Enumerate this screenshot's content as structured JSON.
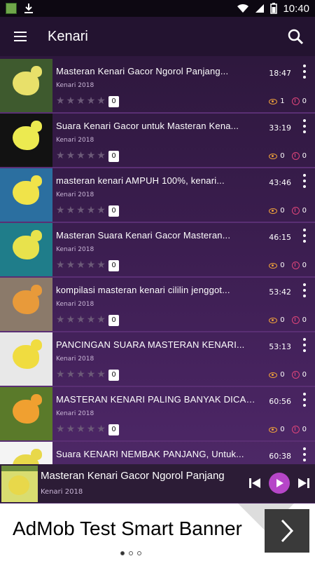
{
  "statusbar": {
    "time": "10:40"
  },
  "appbar": {
    "title": "Kenari"
  },
  "videos": [
    {
      "title": "Masteran Kenari Gacor Ngorol Panjang...",
      "subtitle": "Kenari 2018",
      "duration": "18:47",
      "rating_count": "0",
      "views": "1",
      "downloads": "0",
      "thumb_bg": "#3e5a2e",
      "bird": "#e8e06a"
    },
    {
      "title": "Suara Kenari Gacor untuk Masteran Kena...",
      "subtitle": "Kenari 2018",
      "duration": "33:19",
      "rating_count": "0",
      "views": "0",
      "downloads": "0",
      "thumb_bg": "#121212",
      "bird": "#ecea50"
    },
    {
      "title": "masteran kenari AMPUH 100%, kenari...",
      "subtitle": "Kenari 2018",
      "duration": "43:46",
      "rating_count": "0",
      "views": "0",
      "downloads": "0",
      "thumb_bg": "#2b6fa0",
      "bird": "#f0e34a"
    },
    {
      "title": "Masteran Suara Kenari Gacor Masteran...",
      "subtitle": "Kenari 2018",
      "duration": "46:15",
      "rating_count": "0",
      "views": "0",
      "downloads": "0",
      "thumb_bg": "#1f7d8a",
      "bird": "#e8e24c"
    },
    {
      "title": "kompilasi masteran kenari cililin jenggot...",
      "subtitle": "Kenari 2018",
      "duration": "53:42",
      "rating_count": "0",
      "views": "0",
      "downloads": "0",
      "thumb_bg": "#8b7a6a",
      "bird": "#e89a3a"
    },
    {
      "title": "PANCINGAN SUARA MASTERAN KENARI...",
      "subtitle": "Kenari 2018",
      "duration": "53:13",
      "rating_count": "0",
      "views": "0",
      "downloads": "0",
      "thumb_bg": "#e8e8e8",
      "bird": "#f0dc40"
    },
    {
      "title": "MASTERAN KENARI PALING BANYAK DICAR...",
      "subtitle": "Kenari 2018",
      "duration": "60:56",
      "rating_count": "0",
      "views": "0",
      "downloads": "0",
      "thumb_bg": "#5a7a2a",
      "bird": "#f0a030"
    },
    {
      "title": "Suara KENARI NEMBAK PANJANG, Untuk...",
      "subtitle": "",
      "duration": "60:38",
      "rating_count": "",
      "views": "",
      "downloads": "",
      "thumb_bg": "#f4f4f4",
      "bird": "#e8d84a"
    }
  ],
  "player": {
    "title": "Masteran Kenari Gacor Ngorol Panjang",
    "subtitle": "Kenari 2018"
  },
  "ad": {
    "text": "AdMob Test Smart Banner"
  },
  "colors": {
    "accent": "#b646c8",
    "divider": "#5a2f74",
    "views": "#f0a23a",
    "downloads": "#e0457a"
  }
}
